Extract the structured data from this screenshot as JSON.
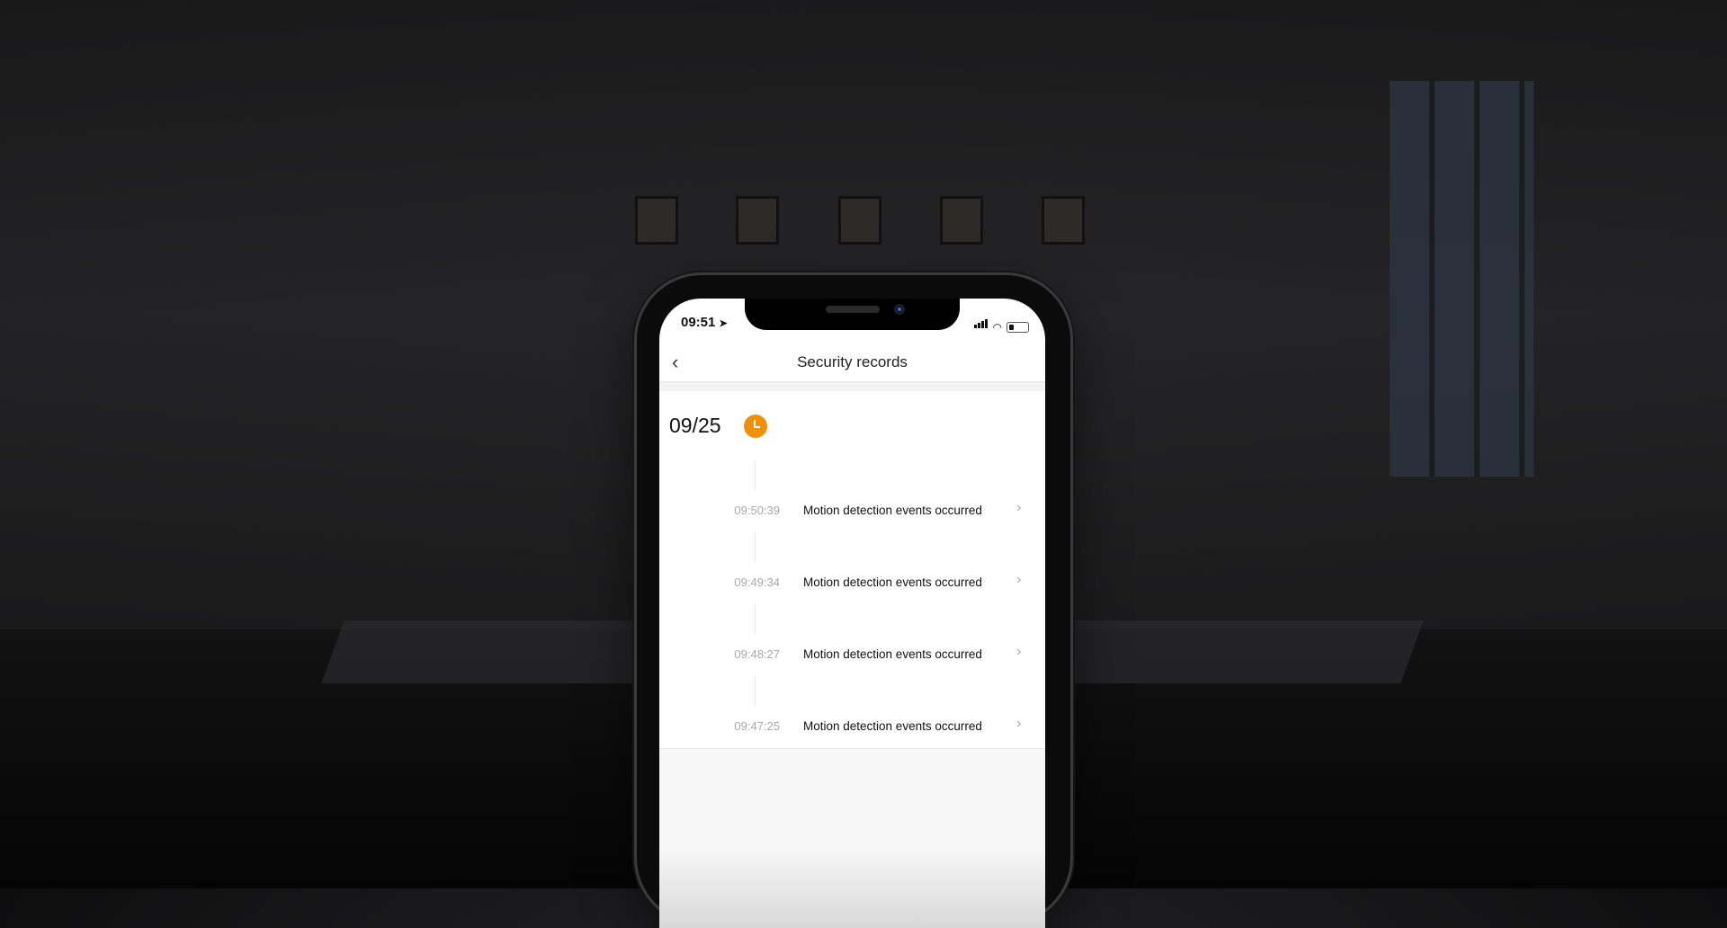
{
  "status_bar": {
    "time": "09:51"
  },
  "header": {
    "title": "Security records",
    "back_icon": "chevron-left-icon"
  },
  "date": "09/25",
  "accent_color": "#f0900a",
  "records": [
    {
      "time": "09:50:39",
      "message": "Motion detection events occurred"
    },
    {
      "time": "09:49:34",
      "message": "Motion detection events occurred"
    },
    {
      "time": "09:48:27",
      "message": "Motion detection events occurred"
    },
    {
      "time": "09:47:25",
      "message": "Motion detection events occurred"
    }
  ]
}
